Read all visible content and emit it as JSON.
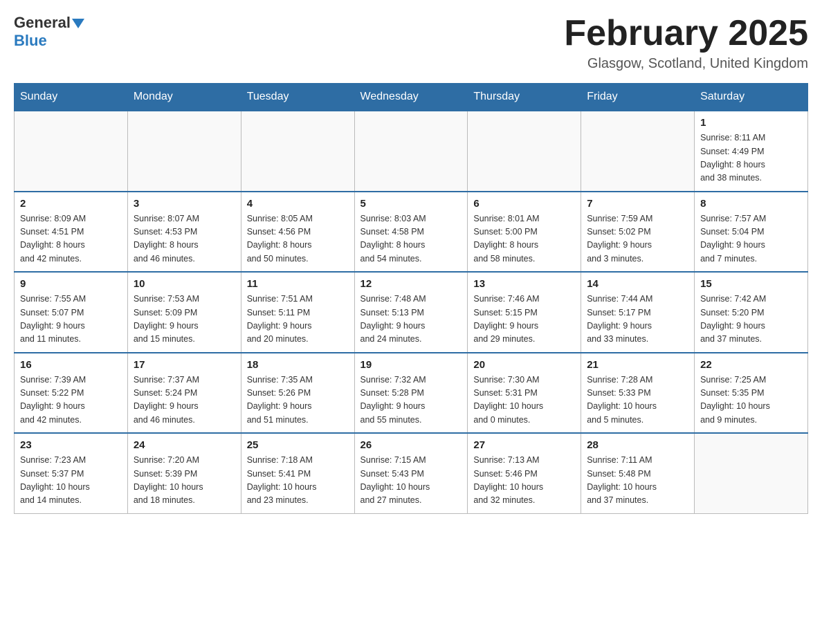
{
  "header": {
    "logo_general": "General",
    "logo_blue": "Blue",
    "month_title": "February 2025",
    "location": "Glasgow, Scotland, United Kingdom"
  },
  "weekdays": [
    "Sunday",
    "Monday",
    "Tuesday",
    "Wednesday",
    "Thursday",
    "Friday",
    "Saturday"
  ],
  "weeks": [
    [
      {
        "day": "",
        "info": ""
      },
      {
        "day": "",
        "info": ""
      },
      {
        "day": "",
        "info": ""
      },
      {
        "day": "",
        "info": ""
      },
      {
        "day": "",
        "info": ""
      },
      {
        "day": "",
        "info": ""
      },
      {
        "day": "1",
        "info": "Sunrise: 8:11 AM\nSunset: 4:49 PM\nDaylight: 8 hours\nand 38 minutes."
      }
    ],
    [
      {
        "day": "2",
        "info": "Sunrise: 8:09 AM\nSunset: 4:51 PM\nDaylight: 8 hours\nand 42 minutes."
      },
      {
        "day": "3",
        "info": "Sunrise: 8:07 AM\nSunset: 4:53 PM\nDaylight: 8 hours\nand 46 minutes."
      },
      {
        "day": "4",
        "info": "Sunrise: 8:05 AM\nSunset: 4:56 PM\nDaylight: 8 hours\nand 50 minutes."
      },
      {
        "day": "5",
        "info": "Sunrise: 8:03 AM\nSunset: 4:58 PM\nDaylight: 8 hours\nand 54 minutes."
      },
      {
        "day": "6",
        "info": "Sunrise: 8:01 AM\nSunset: 5:00 PM\nDaylight: 8 hours\nand 58 minutes."
      },
      {
        "day": "7",
        "info": "Sunrise: 7:59 AM\nSunset: 5:02 PM\nDaylight: 9 hours\nand 3 minutes."
      },
      {
        "day": "8",
        "info": "Sunrise: 7:57 AM\nSunset: 5:04 PM\nDaylight: 9 hours\nand 7 minutes."
      }
    ],
    [
      {
        "day": "9",
        "info": "Sunrise: 7:55 AM\nSunset: 5:07 PM\nDaylight: 9 hours\nand 11 minutes."
      },
      {
        "day": "10",
        "info": "Sunrise: 7:53 AM\nSunset: 5:09 PM\nDaylight: 9 hours\nand 15 minutes."
      },
      {
        "day": "11",
        "info": "Sunrise: 7:51 AM\nSunset: 5:11 PM\nDaylight: 9 hours\nand 20 minutes."
      },
      {
        "day": "12",
        "info": "Sunrise: 7:48 AM\nSunset: 5:13 PM\nDaylight: 9 hours\nand 24 minutes."
      },
      {
        "day": "13",
        "info": "Sunrise: 7:46 AM\nSunset: 5:15 PM\nDaylight: 9 hours\nand 29 minutes."
      },
      {
        "day": "14",
        "info": "Sunrise: 7:44 AM\nSunset: 5:17 PM\nDaylight: 9 hours\nand 33 minutes."
      },
      {
        "day": "15",
        "info": "Sunrise: 7:42 AM\nSunset: 5:20 PM\nDaylight: 9 hours\nand 37 minutes."
      }
    ],
    [
      {
        "day": "16",
        "info": "Sunrise: 7:39 AM\nSunset: 5:22 PM\nDaylight: 9 hours\nand 42 minutes."
      },
      {
        "day": "17",
        "info": "Sunrise: 7:37 AM\nSunset: 5:24 PM\nDaylight: 9 hours\nand 46 minutes."
      },
      {
        "day": "18",
        "info": "Sunrise: 7:35 AM\nSunset: 5:26 PM\nDaylight: 9 hours\nand 51 minutes."
      },
      {
        "day": "19",
        "info": "Sunrise: 7:32 AM\nSunset: 5:28 PM\nDaylight: 9 hours\nand 55 minutes."
      },
      {
        "day": "20",
        "info": "Sunrise: 7:30 AM\nSunset: 5:31 PM\nDaylight: 10 hours\nand 0 minutes."
      },
      {
        "day": "21",
        "info": "Sunrise: 7:28 AM\nSunset: 5:33 PM\nDaylight: 10 hours\nand 5 minutes."
      },
      {
        "day": "22",
        "info": "Sunrise: 7:25 AM\nSunset: 5:35 PM\nDaylight: 10 hours\nand 9 minutes."
      }
    ],
    [
      {
        "day": "23",
        "info": "Sunrise: 7:23 AM\nSunset: 5:37 PM\nDaylight: 10 hours\nand 14 minutes."
      },
      {
        "day": "24",
        "info": "Sunrise: 7:20 AM\nSunset: 5:39 PM\nDaylight: 10 hours\nand 18 minutes."
      },
      {
        "day": "25",
        "info": "Sunrise: 7:18 AM\nSunset: 5:41 PM\nDaylight: 10 hours\nand 23 minutes."
      },
      {
        "day": "26",
        "info": "Sunrise: 7:15 AM\nSunset: 5:43 PM\nDaylight: 10 hours\nand 27 minutes."
      },
      {
        "day": "27",
        "info": "Sunrise: 7:13 AM\nSunset: 5:46 PM\nDaylight: 10 hours\nand 32 minutes."
      },
      {
        "day": "28",
        "info": "Sunrise: 7:11 AM\nSunset: 5:48 PM\nDaylight: 10 hours\nand 37 minutes."
      },
      {
        "day": "",
        "info": ""
      }
    ]
  ]
}
